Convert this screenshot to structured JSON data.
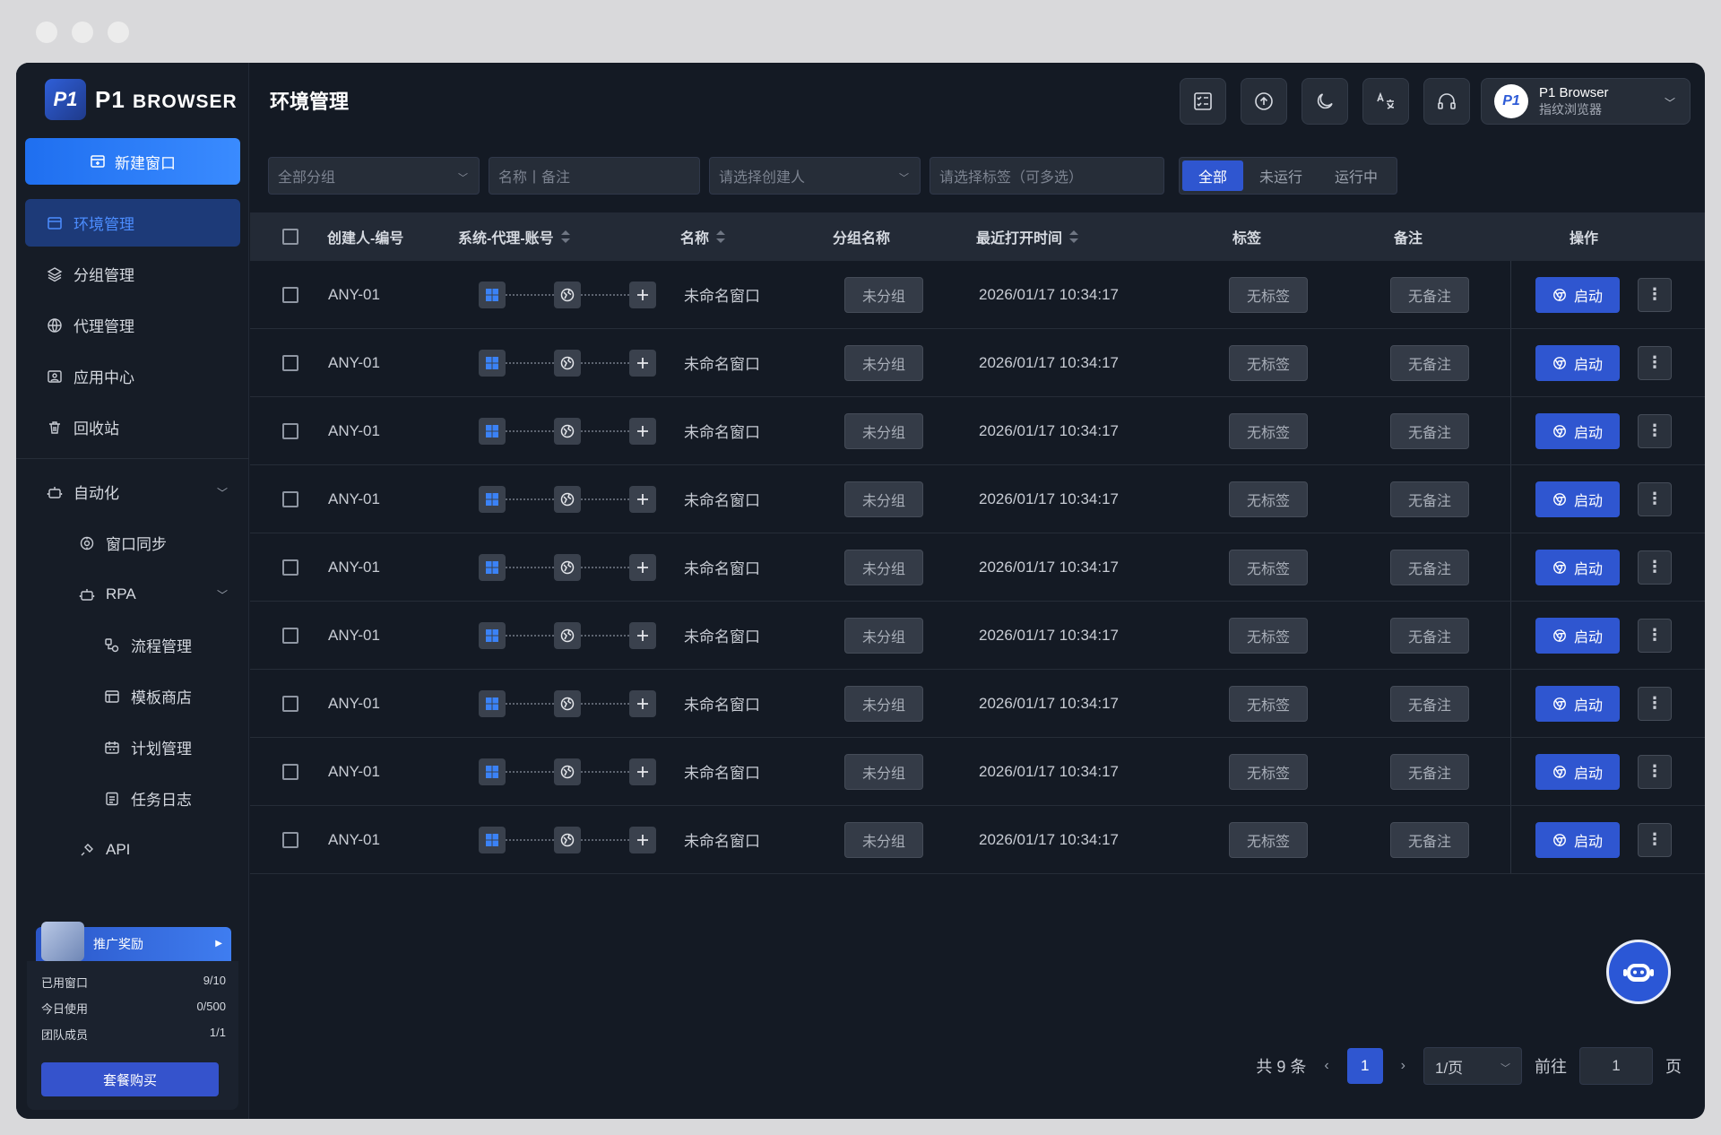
{
  "brand": {
    "logo_mark": "P1",
    "name_big": "P1",
    "name_small": "BROWSER"
  },
  "sidebar": {
    "new_window": "新建窗口",
    "items": [
      {
        "label": "环境管理",
        "icon": "window-icon",
        "active": true
      },
      {
        "label": "分组管理",
        "icon": "layers-icon"
      },
      {
        "label": "代理管理",
        "icon": "globe-icon"
      },
      {
        "label": "应用中心",
        "icon": "app-icon"
      },
      {
        "label": "回收站",
        "icon": "trash-icon"
      }
    ],
    "automation": {
      "label": "自动化",
      "window_sync": "窗口同步",
      "rpa": "RPA",
      "flow": "流程管理",
      "template": "模板商店",
      "plan": "计划管理",
      "tasklog": "任务日志",
      "api": "API"
    },
    "promo": "推广奖励",
    "quota": [
      {
        "label": "已用窗口",
        "value": "9/10"
      },
      {
        "label": "今日使用",
        "value": "0/500"
      },
      {
        "label": "团队成员",
        "value": "1/1"
      }
    ],
    "buy": "套餐购买"
  },
  "header": {
    "title": "环境管理",
    "account_name": "P1 Browser",
    "account_sub": "指纹浏览器",
    "avatar": "P1"
  },
  "filters": {
    "group": "全部分组",
    "name_placeholder": "名称丨备注",
    "creator": "请选择创建人",
    "tags": "请选择标签（可多选）",
    "segments": [
      "全部",
      "未运行",
      "运行中"
    ]
  },
  "table": {
    "headers": {
      "creator": "创建人-编号",
      "system": "系统-代理-账号",
      "name": "名称",
      "group": "分组名称",
      "last_open": "最近打开时间",
      "tag": "标签",
      "remark": "备注",
      "action": "操作"
    },
    "rows": [
      {
        "id": "ANY-01",
        "name": "未命名窗口",
        "group": "未分组",
        "time": "2026/01/17 10:34:17",
        "tag": "无标签",
        "remark": "无备注",
        "start": "启动"
      },
      {
        "id": "ANY-01",
        "name": "未命名窗口",
        "group": "未分组",
        "time": "2026/01/17 10:34:17",
        "tag": "无标签",
        "remark": "无备注",
        "start": "启动"
      },
      {
        "id": "ANY-01",
        "name": "未命名窗口",
        "group": "未分组",
        "time": "2026/01/17 10:34:17",
        "tag": "无标签",
        "remark": "无备注",
        "start": "启动"
      },
      {
        "id": "ANY-01",
        "name": "未命名窗口",
        "group": "未分组",
        "time": "2026/01/17 10:34:17",
        "tag": "无标签",
        "remark": "无备注",
        "start": "启动"
      },
      {
        "id": "ANY-01",
        "name": "未命名窗口",
        "group": "未分组",
        "time": "2026/01/17 10:34:17",
        "tag": "无标签",
        "remark": "无备注",
        "start": "启动"
      },
      {
        "id": "ANY-01",
        "name": "未命名窗口",
        "group": "未分组",
        "time": "2026/01/17 10:34:17",
        "tag": "无标签",
        "remark": "无备注",
        "start": "启动"
      },
      {
        "id": "ANY-01",
        "name": "未命名窗口",
        "group": "未分组",
        "time": "2026/01/17 10:34:17",
        "tag": "无标签",
        "remark": "无备注",
        "start": "启动"
      },
      {
        "id": "ANY-01",
        "name": "未命名窗口",
        "group": "未分组",
        "time": "2026/01/17 10:34:17",
        "tag": "无标签",
        "remark": "无备注",
        "start": "启动"
      },
      {
        "id": "ANY-01",
        "name": "未命名窗口",
        "group": "未分组",
        "time": "2026/01/17 10:34:17",
        "tag": "无标签",
        "remark": "无备注",
        "start": "启动"
      }
    ]
  },
  "pager": {
    "total": "共 9 条",
    "page": "1",
    "size": "1/页",
    "goto": "前往",
    "goto_value": "1",
    "unit": "页"
  },
  "colors": {
    "accent": "#2f56d0",
    "bg": "#141a24",
    "sidebar_active": "#1d3a78"
  }
}
